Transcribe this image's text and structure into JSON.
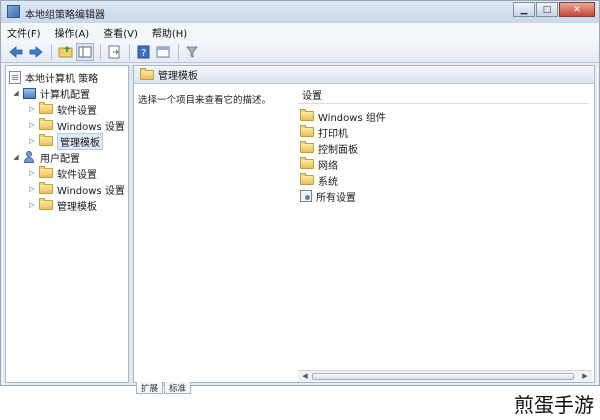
{
  "window": {
    "title": "本地组策略编辑器"
  },
  "menu": [
    "文件(F)",
    "操作(A)",
    "查看(V)",
    "帮助(H)"
  ],
  "toolbar_icons": [
    "back-arrow-icon",
    "forward-arrow-icon",
    "up-folder-icon",
    "show-hide-tree-icon",
    "export-list-icon",
    "help-icon",
    "properties-icon",
    "filter-icon"
  ],
  "tree": {
    "root": "本地计算机 策略",
    "computer": "计算机配置",
    "computer_children": [
      "软件设置",
      "Windows 设置",
      "管理模板"
    ],
    "user": "用户配置",
    "user_children": [
      "软件设置",
      "Windows 设置",
      "管理模板"
    ]
  },
  "right": {
    "header": "管理模板",
    "description": "选择一个项目来查看它的描述。",
    "column": "设置",
    "items": [
      "Windows 组件",
      "打印机",
      "控制面板",
      "网络",
      "系统",
      "所有设置"
    ]
  },
  "tabs": [
    "扩展",
    "标准"
  ],
  "watermark": "煎蛋手游"
}
